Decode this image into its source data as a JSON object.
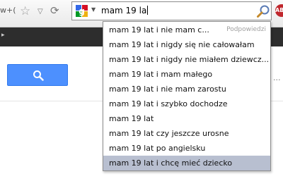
{
  "toolbar": {
    "url_tail": "w+("
  },
  "search_box": {
    "query": "mam 19 la",
    "engine_icon": "google-icon"
  },
  "addon": {
    "label": "ABP"
  },
  "dropdown": {
    "hint": "Podpowiedzi",
    "suggestions": [
      "mam 19 lat i nie mam c...",
      "mam 19 lat i nigdy się nie całowałam",
      "mam 19 lat i nigdy nie miałem dziewcz...",
      "mam 19 lat i mam małego",
      "mam 19 lat i nie mam zarostu",
      "mam 19 lat i szybko dochodze",
      "mam 19 lat",
      "mam 19 lat czy jeszcze urosne",
      "mam 19 lat po angielsku",
      "mam 19 lat i chcę mieć dziecko"
    ],
    "selected_index": 9
  },
  "page": {
    "ellipsis": "..."
  },
  "colors": {
    "search_button": "#4d90fe",
    "selected_row": "#b8bfd0",
    "dark_bar": "#2d2d2d"
  }
}
